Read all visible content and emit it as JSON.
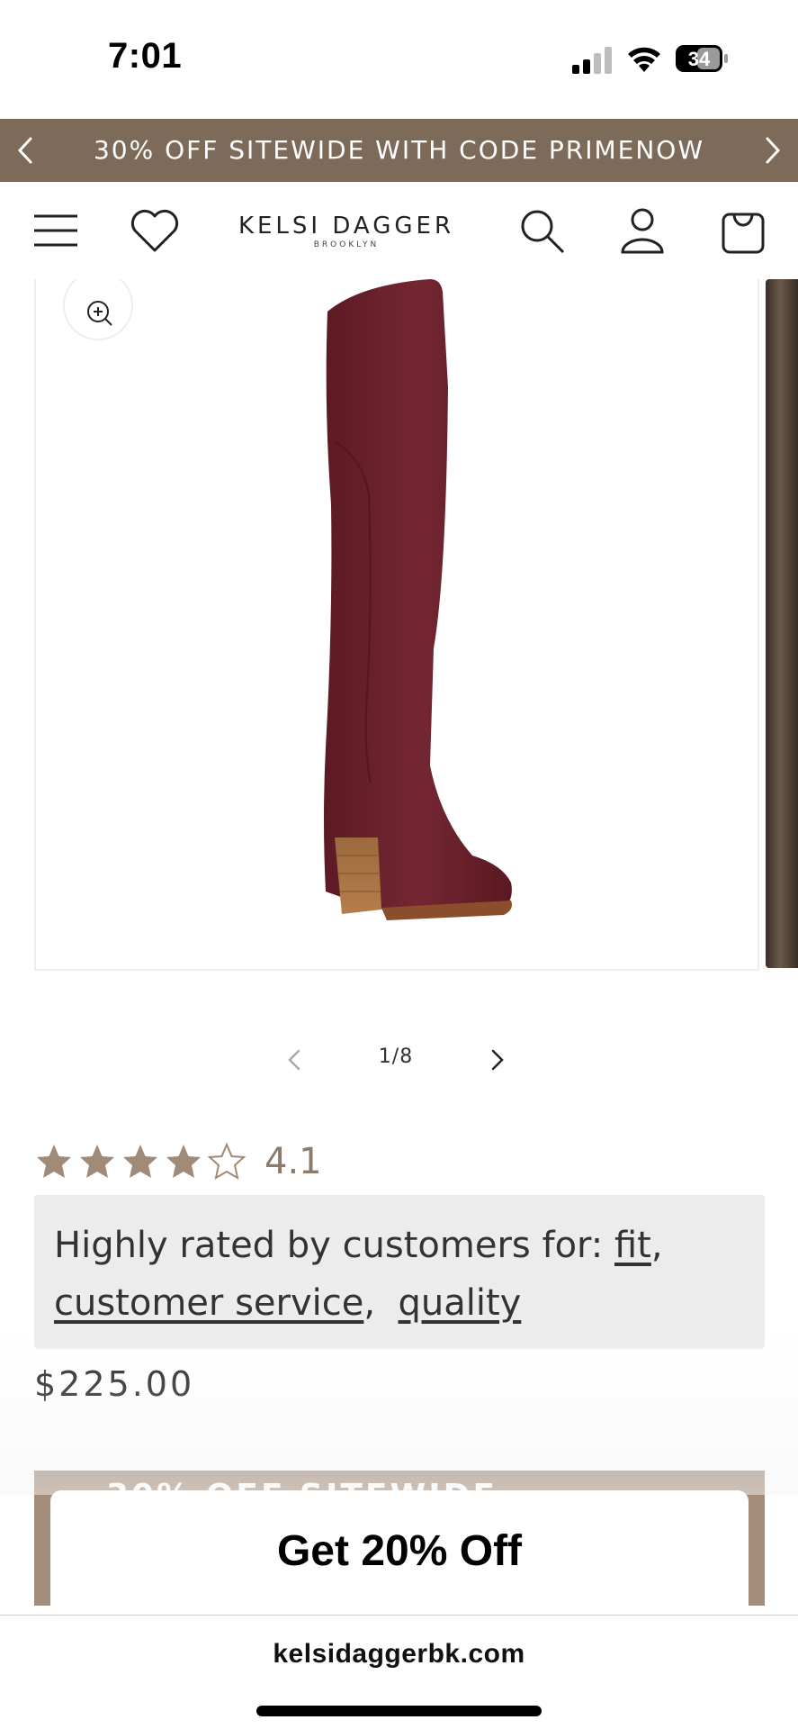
{
  "status_bar": {
    "time": "7:01",
    "battery_level": "34",
    "signal_icon": "cellular-signal-icon",
    "wifi_icon": "wifi-icon",
    "battery_icon": "battery-icon"
  },
  "promo_bar": {
    "text": "30% OFF SITEWIDE WITH CODE PRIMENOW",
    "prev_icon": "chevron-left-icon",
    "next_icon": "chevron-right-icon",
    "color": "#7e6a58"
  },
  "header": {
    "logo_main": "KELSI DAGGER",
    "logo_sub": "BROOKLYN",
    "icons": [
      "menu-icon",
      "heart-icon",
      "search-icon",
      "account-icon",
      "cart-icon"
    ]
  },
  "gallery": {
    "zoom_icon": "zoom-in-icon",
    "current": "1",
    "total": "8",
    "counter_text": "1/8",
    "prev_icon": "chevron-left-icon",
    "next_icon": "chevron-right-icon",
    "boot_color": "#6b1e27"
  },
  "rating": {
    "value": "4.1",
    "stars_filled": 4,
    "stars_total": 5,
    "star_color": "#a08a78"
  },
  "highlights": {
    "prefix": "Highly rated by customers for:",
    "items": [
      "fit",
      "customer service",
      "quality"
    ]
  },
  "price": "$225.00",
  "behind_banner": {
    "text": "30% OFF SITEWIDE",
    "color": "#a48c7a"
  },
  "popup": {
    "title": "Get 20% Off"
  },
  "browser": {
    "url": "kelsidaggerbk.com"
  }
}
